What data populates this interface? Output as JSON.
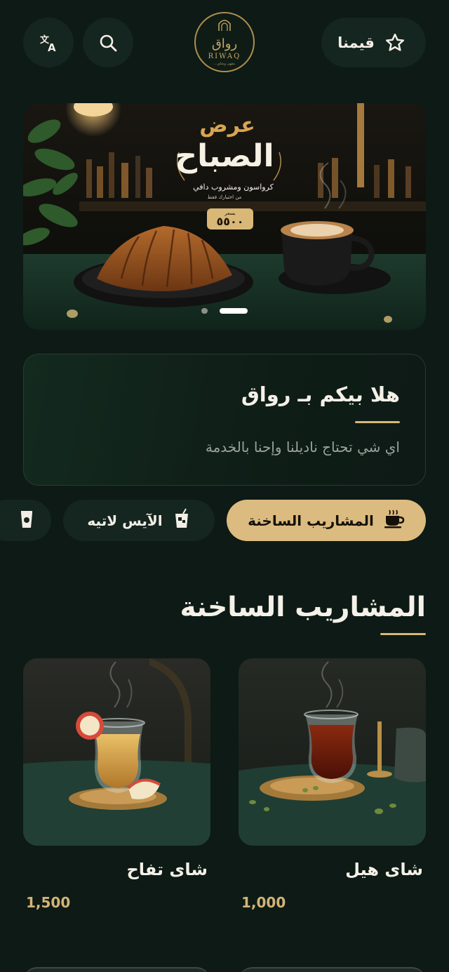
{
  "header": {
    "rate_label": "قيمنا",
    "logo_ar": "رواق",
    "logo_en": "RIWAQ",
    "logo_tagline": "...مقهى وشاي"
  },
  "banner": {
    "line1": "عرض",
    "line2": "الصباح",
    "line3": "كرواسون ومشروب دافي",
    "line4": "من اختيارك فقط",
    "price_prefix": "بسعر",
    "price": "٥٥٠٠",
    "slides": 2,
    "active_slide": 1
  },
  "welcome": {
    "title": "هلا بيكم بـ رواق",
    "subtitle": "اي شي تحتاج ناديلنا وإحنا بالخدمة"
  },
  "categories": [
    {
      "label": "المشاريب الساخنة",
      "icon": "coffee-cup-icon",
      "active": true
    },
    {
      "label": "الآيس لاتيه",
      "icon": "iced-cup-icon",
      "active": false
    },
    {
      "label": "",
      "icon": "juice-cup-icon",
      "active": false
    }
  ],
  "section": {
    "title": "المشاريب الساخنة"
  },
  "products": [
    {
      "name": "شاى هيل",
      "price": "1,000"
    },
    {
      "name": "شاى تفاح",
      "price": "1,500"
    }
  ],
  "colors": {
    "background": "#0d1a15",
    "accent": "#dcbb80",
    "surface": "#15251f"
  }
}
